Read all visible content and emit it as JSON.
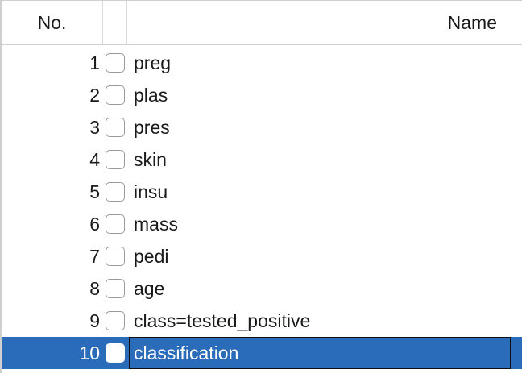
{
  "table": {
    "headers": {
      "no": "No.",
      "name": "Name"
    },
    "rows": [
      {
        "no": "1",
        "name": "preg",
        "checked": false
      },
      {
        "no": "2",
        "name": "plas",
        "checked": false
      },
      {
        "no": "3",
        "name": "pres",
        "checked": false
      },
      {
        "no": "4",
        "name": "skin",
        "checked": false
      },
      {
        "no": "5",
        "name": "insu",
        "checked": false
      },
      {
        "no": "6",
        "name": "mass",
        "checked": false
      },
      {
        "no": "7",
        "name": "pedi",
        "checked": false
      },
      {
        "no": "8",
        "name": "age",
        "checked": false
      },
      {
        "no": "9",
        "name": "class=tested_positive",
        "checked": false
      },
      {
        "no": "10",
        "name": "classification",
        "checked": false,
        "selected": true
      }
    ]
  },
  "colors": {
    "selection": "#2a6bba",
    "grid": "#cfcfcf"
  }
}
